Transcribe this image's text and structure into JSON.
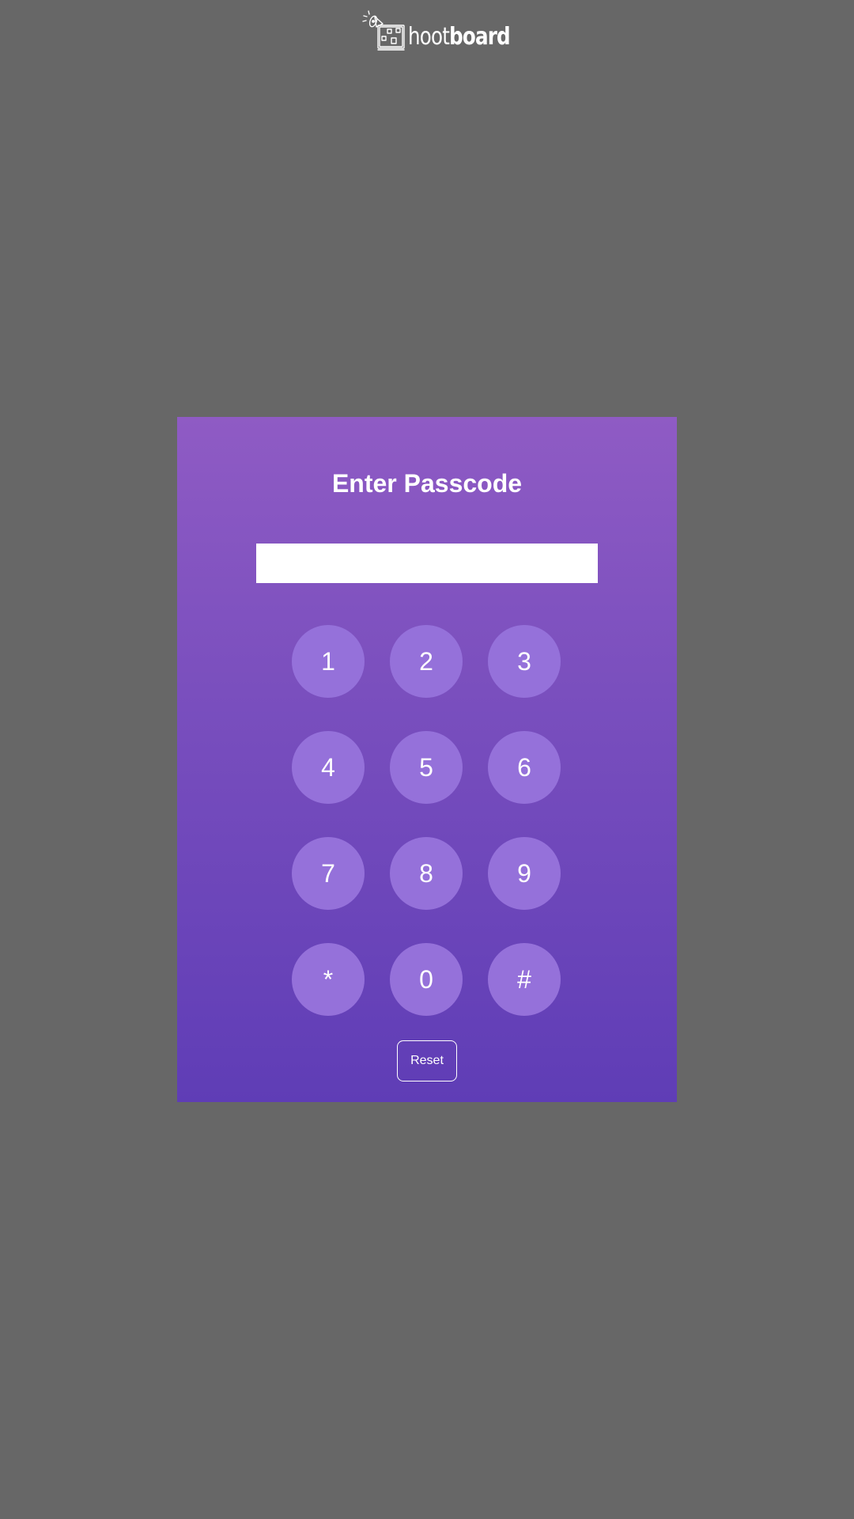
{
  "header": {
    "logo": {
      "icon": "hootboard-logo-icon",
      "text_light": "hoot",
      "text_bold": "board"
    }
  },
  "passcode_panel": {
    "title": "Enter Passcode",
    "input": {
      "value": "",
      "placeholder": ""
    },
    "keys": [
      "1",
      "2",
      "3",
      "4",
      "5",
      "6",
      "7",
      "8",
      "9",
      "*",
      "0",
      "#"
    ],
    "reset_label": "Reset"
  },
  "colors": {
    "page_background": "#676767",
    "panel_gradient_top": "#8f5bc4",
    "panel_gradient_bottom": "#5f3db6",
    "key_background": "#9571da",
    "text": "#ffffff"
  }
}
